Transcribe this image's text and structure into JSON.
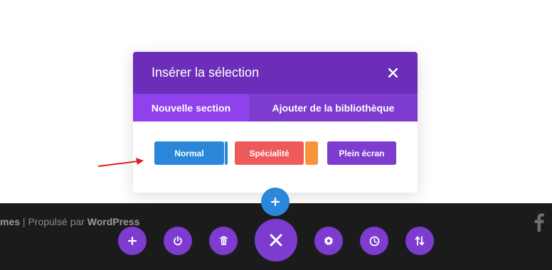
{
  "modal": {
    "title": "Insérer la sélection",
    "tabs": [
      {
        "label": "Nouvelle section",
        "active": true
      },
      {
        "label": "Ajouter de la bibliothèque",
        "active": false
      }
    ],
    "section_types": [
      {
        "label": "Normal",
        "color": "#2b87da"
      },
      {
        "label": "Spécialité",
        "color": "#ee5a5a"
      },
      {
        "label": "Plein écran",
        "color": "#7e3bd0"
      }
    ]
  },
  "footer": {
    "credit_prefix": "mes",
    "separator": "|",
    "powered_by": "Propulsé par",
    "platform": "WordPress"
  },
  "toolbar": {
    "icons": [
      "plus-icon",
      "power-icon",
      "trash-icon",
      "close-icon",
      "gear-icon",
      "history-icon",
      "sort-icon"
    ]
  },
  "colors": {
    "header": "#6c2eb9",
    "tab_active": "#8f42ec",
    "toolbar": "#7e3bd0",
    "blue": "#2b87da",
    "arrow": "#e02020"
  }
}
